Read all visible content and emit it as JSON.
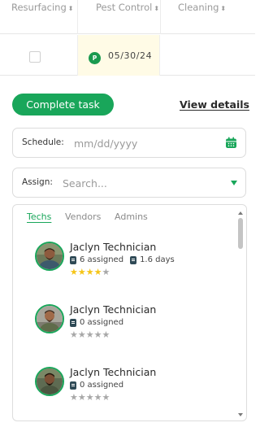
{
  "table": {
    "headers": [
      {
        "label": "Resurfacing",
        "sort": "⬍"
      },
      {
        "label": "Pest Control",
        "sort": "⬍"
      },
      {
        "label": "Cleaning",
        "sort": "⬍"
      }
    ],
    "row": {
      "pest_control_badge": "P",
      "pest_control_date": "05/30/24"
    }
  },
  "panel": {
    "complete_label": "Complete task",
    "view_details_label": "View details",
    "schedule": {
      "label": "Schedule:",
      "placeholder": "mm/dd/yyyy"
    },
    "assign": {
      "label": "Assign:",
      "placeholder": "Search..."
    },
    "tabs": [
      "Techs",
      "Vendors",
      "Admins"
    ],
    "active_tab": "Techs",
    "techs": [
      {
        "name": "Jaclyn Technician",
        "assigned": "6 assigned",
        "days": "1.6 days",
        "rating": 4
      },
      {
        "name": "Jaclyn Technician",
        "assigned": "0 assigned",
        "days": "",
        "rating": 0
      },
      {
        "name": "Jaclyn Technician",
        "assigned": "0 assigned",
        "days": "",
        "rating": 0
      }
    ]
  },
  "colors": {
    "accent": "#19a65a",
    "star_on": "#f5c518",
    "star_off": "#a8a8a8",
    "highlight_cell": "#fffbe6"
  }
}
